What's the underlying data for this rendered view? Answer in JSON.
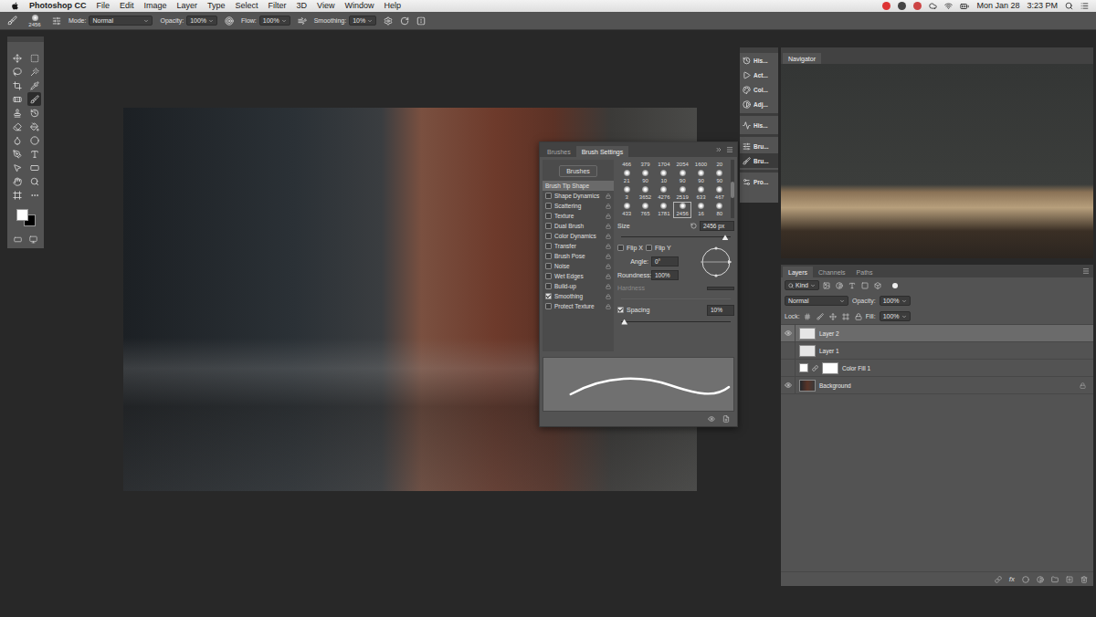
{
  "menu_bar": {
    "app": "Photoshop CC",
    "items": [
      "File",
      "Edit",
      "Image",
      "Layer",
      "Type",
      "Select",
      "Filter",
      "3D",
      "View",
      "Window",
      "Help"
    ],
    "date": "Mon Jan 28",
    "time": "3:23 PM"
  },
  "options_bar": {
    "brush_size": "2456",
    "fields": [
      {
        "label": "Mode:",
        "value": "Normal",
        "kind": "dropdown"
      },
      {
        "label": "Opacity:",
        "value": "100%",
        "kind": "number"
      },
      {
        "label": "Flow:",
        "value": "100%",
        "kind": "number"
      },
      {
        "label": "Smoothing:",
        "value": "10%",
        "kind": "number"
      }
    ]
  },
  "tools": [
    {
      "selected": false
    },
    {
      "selected": false
    },
    {
      "selected": false
    },
    {
      "selected": false
    },
    {
      "selected": false
    },
    {
      "selected": false
    },
    {
      "selected": false
    },
    {
      "selected": true
    },
    {
      "selected": false
    },
    {
      "selected": false
    },
    {
      "selected": false
    },
    {
      "selected": false
    },
    {
      "selected": false
    },
    {
      "selected": false
    },
    {
      "selected": false
    },
    {
      "selected": false
    },
    {
      "selected": false
    },
    {
      "selected": false
    },
    {
      "selected": false
    },
    {
      "selected": false
    },
    {
      "selected": false
    },
    {
      "selected": false
    }
  ],
  "colors": {
    "foreground": "#ffffff",
    "background": "#000000"
  },
  "brush_settings": {
    "tabs": [
      {
        "label": "Brushes",
        "selected": false
      },
      {
        "label": "Brush Settings",
        "selected": true
      }
    ],
    "presets_button": "Brushes",
    "options": [
      {
        "label": "Brush Tip Shape",
        "kind": "header",
        "checked": false,
        "selected": true
      },
      {
        "label": "Shape Dynamics",
        "kind": "option",
        "checked": false,
        "selected": false
      },
      {
        "label": "Scattering",
        "kind": "option",
        "checked": false,
        "selected": false
      },
      {
        "label": "Texture",
        "kind": "option",
        "checked": false,
        "selected": false
      },
      {
        "label": "Dual Brush",
        "kind": "option",
        "checked": false,
        "selected": false
      },
      {
        "label": "Color Dynamics",
        "kind": "option",
        "checked": false,
        "selected": false
      },
      {
        "label": "Transfer",
        "kind": "option",
        "checked": false,
        "selected": false
      },
      {
        "label": "Brush Pose",
        "kind": "option",
        "checked": false,
        "selected": false
      },
      {
        "label": "Noise",
        "kind": "option",
        "checked": false,
        "selected": false
      },
      {
        "label": "Wet Edges",
        "kind": "option",
        "checked": false,
        "selected": false
      },
      {
        "label": "Build-up",
        "kind": "option",
        "checked": false,
        "selected": false
      },
      {
        "label": "Smoothing",
        "kind": "option",
        "checked": true,
        "selected": false
      },
      {
        "label": "Protect Texture",
        "kind": "option",
        "checked": false,
        "selected": false
      }
    ],
    "tips": [
      [
        {
          "size": "466",
          "selected": false
        },
        {
          "size": "379",
          "selected": false
        },
        {
          "size": "1704",
          "selected": false
        },
        {
          "size": "2054",
          "selected": false
        },
        {
          "size": "1600",
          "selected": false
        },
        {
          "size": "20",
          "selected": false
        }
      ],
      [
        {
          "size": "21",
          "selected": false
        },
        {
          "size": "90",
          "selected": false
        },
        {
          "size": "10",
          "selected": false
        },
        {
          "size": "90",
          "selected": false
        },
        {
          "size": "90",
          "selected": false
        },
        {
          "size": "90",
          "selected": false
        }
      ],
      [
        {
          "size": "3",
          "selected": false
        },
        {
          "size": "3652",
          "selected": false
        },
        {
          "size": "4276",
          "selected": false
        },
        {
          "size": "2519",
          "selected": false
        },
        {
          "size": "633",
          "selected": false
        },
        {
          "size": "467",
          "selected": false
        }
      ],
      [
        {
          "size": "433",
          "selected": false
        },
        {
          "size": "765",
          "selected": false
        },
        {
          "size": "1781",
          "selected": false
        },
        {
          "size": "2456",
          "selected": true
        },
        {
          "size": "16",
          "selected": false
        },
        {
          "size": "80",
          "selected": false
        }
      ]
    ],
    "size": {
      "label": "Size",
      "value": "2456 px",
      "level": 0.95
    },
    "flips": [
      {
        "label": "Flip X",
        "checked": false
      },
      {
        "label": "Flip Y",
        "checked": false
      }
    ],
    "angle": {
      "label": "Angle:",
      "value": "0°"
    },
    "roundness": {
      "label": "Roundness:",
      "value": "100%"
    },
    "hardness": {
      "label": "Hardness",
      "disabled": true
    },
    "spacing": {
      "label": "Spacing",
      "checked": true,
      "value": "10%",
      "level": 0.03
    }
  },
  "panel_strip": [
    {
      "label": "His...",
      "selected": false
    },
    {
      "label": "Act...",
      "selected": false
    },
    {
      "label": "Col...",
      "selected": false
    },
    {
      "label": "Adj...",
      "selected": false
    },
    {
      "label": "His...",
      "selected": false
    },
    {
      "label": "Bru...",
      "selected": false
    },
    {
      "label": "Bru...",
      "selected": true
    },
    {
      "label": "Pro...",
      "selected": false
    }
  ],
  "navigator": {
    "title": "Navigator"
  },
  "layers": {
    "tabs": [
      {
        "label": "Layers",
        "selected": true
      },
      {
        "label": "Channels",
        "selected": false
      },
      {
        "label": "Paths",
        "selected": false
      }
    ],
    "filter": "Kind",
    "blend_mode": "Normal",
    "opacity_label": "Opacity:",
    "opacity": "100%",
    "lock_label": "Lock:",
    "fill_label": "Fill:",
    "fill": "100%",
    "items": [
      {
        "name": "Layer 2",
        "kind": "pixel",
        "visible": true,
        "selected": true,
        "locked": false
      },
      {
        "name": "Layer 1",
        "kind": "pixel",
        "visible": false,
        "selected": false,
        "locked": false
      },
      {
        "name": "Color Fill 1",
        "kind": "fill",
        "visible": false,
        "selected": false,
        "locked": false
      },
      {
        "name": "Background",
        "kind": "background",
        "visible": true,
        "selected": false,
        "locked": true
      }
    ],
    "fx": "fx"
  }
}
